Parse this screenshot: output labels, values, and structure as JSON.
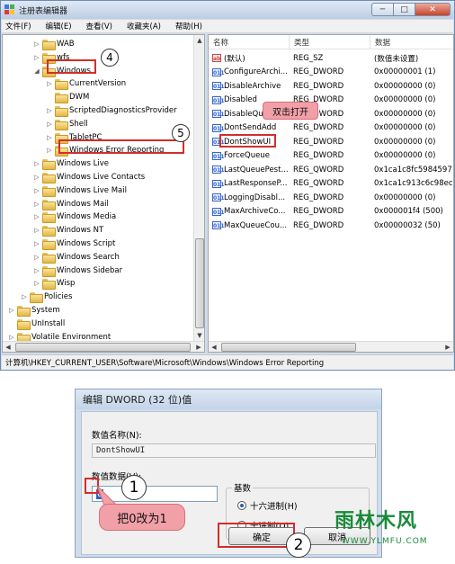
{
  "regedit": {
    "title": "注册表编辑器",
    "menu": [
      "文件(F)",
      "编辑(E)",
      "查看(V)",
      "收藏夹(A)",
      "帮助(H)"
    ],
    "window_buttons": {
      "min": "─",
      "max": "□",
      "close": "✕"
    },
    "tree": [
      {
        "label": "WAB",
        "indent": 3,
        "exp": "▷"
      },
      {
        "label": "wfs",
        "indent": 3,
        "exp": "▷"
      },
      {
        "label": "Windows",
        "indent": 3,
        "exp": "◢"
      },
      {
        "label": "CurrentVersion",
        "indent": 4,
        "exp": "▷"
      },
      {
        "label": "DWM",
        "indent": 4,
        "exp": ""
      },
      {
        "label": "ScriptedDiagnosticsProvider",
        "indent": 4,
        "exp": "▷"
      },
      {
        "label": "Shell",
        "indent": 4,
        "exp": "▷"
      },
      {
        "label": "TabletPC",
        "indent": 4,
        "exp": "▷"
      },
      {
        "label": "Windows Error Reporting",
        "indent": 4,
        "exp": "▷"
      },
      {
        "label": "Windows Live",
        "indent": 3,
        "exp": "▷"
      },
      {
        "label": "Windows Live Contacts",
        "indent": 3,
        "exp": "▷"
      },
      {
        "label": "Windows Live Mail",
        "indent": 3,
        "exp": "▷"
      },
      {
        "label": "Windows Mail",
        "indent": 3,
        "exp": "▷"
      },
      {
        "label": "Windows Media",
        "indent": 3,
        "exp": "▷"
      },
      {
        "label": "Windows NT",
        "indent": 3,
        "exp": "▷"
      },
      {
        "label": "Windows Script",
        "indent": 3,
        "exp": "▷"
      },
      {
        "label": "Windows Search",
        "indent": 3,
        "exp": "▷"
      },
      {
        "label": "Windows Sidebar",
        "indent": 3,
        "exp": "▷"
      },
      {
        "label": "Wisp",
        "indent": 3,
        "exp": "▷"
      },
      {
        "label": "Policies",
        "indent": 2,
        "exp": "▷"
      },
      {
        "label": "System",
        "indent": 1,
        "exp": "▷"
      },
      {
        "label": "UnInstall",
        "indent": 1,
        "exp": ""
      },
      {
        "label": "Volatile Environment",
        "indent": 1,
        "exp": "▷"
      }
    ],
    "columns": [
      "名称",
      "类型",
      "数据"
    ],
    "values": [
      {
        "icon": "ab",
        "name": "(默认)",
        "type": "REG_SZ",
        "data": "(数值未设置)"
      },
      {
        "icon": "dw",
        "name": "ConfigureArchi...",
        "type": "REG_DWORD",
        "data": "0x00000001 (1)"
      },
      {
        "icon": "dw",
        "name": "DisableArchive",
        "type": "REG_DWORD",
        "data": "0x00000000 (0)"
      },
      {
        "icon": "dw",
        "name": "Disabled",
        "type": "REG_DWORD",
        "data": "0x00000000 (0)"
      },
      {
        "icon": "dw",
        "name": "DisableQu",
        "type": "REG_DWORD",
        "data": "0x00000000 (0)"
      },
      {
        "icon": "dw",
        "name": "DontSendAdd",
        "type": "REG_DWORD",
        "data": "0x00000000 (0)"
      },
      {
        "icon": "dw",
        "name": "DontShowUI",
        "type": "REG_DWORD",
        "data": "0x00000000 (0)"
      },
      {
        "icon": "dw",
        "name": "ForceQueue",
        "type": "REG_DWORD",
        "data": "0x00000000 (0)"
      },
      {
        "icon": "dw",
        "name": "LastQueuePest...",
        "type": "REG_QWORD",
        "data": "0x1ca1c8fc5984597"
      },
      {
        "icon": "dw",
        "name": "LastResponseP...",
        "type": "REG_QWORD",
        "data": "0x1ca1c913c6c98ec"
      },
      {
        "icon": "dw",
        "name": "LoggingDisabl...",
        "type": "REG_DWORD",
        "data": "0x00000000 (0)"
      },
      {
        "icon": "dw",
        "name": "MaxArchiveCo...",
        "type": "REG_DWORD",
        "data": "0x000001f4 (500)"
      },
      {
        "icon": "dw",
        "name": "MaxQueueCou...",
        "type": "REG_DWORD",
        "data": "0x00000032 (50)"
      }
    ],
    "status": "计算机\\HKEY_CURRENT_USER\\Software\\Microsoft\\Windows\\Windows Error Reporting",
    "callout_double_click": "双击打开",
    "steps": {
      "s4": "4",
      "s5": "5"
    }
  },
  "dialog": {
    "title": "编辑 DWORD (32 位)值",
    "name_label": "数值名称(N):",
    "name_value": "DontShowUI",
    "data_label": "数值数据(V):",
    "data_value": "0",
    "base_label": "基数",
    "radio_hex": "十六进制(H)",
    "radio_dec": "十进制(D)",
    "ok_label": "确定",
    "cancel_label": "取消",
    "callout_change": "把0改为1",
    "steps": {
      "s1": "1",
      "s2": "2"
    }
  },
  "watermark": {
    "logo": "雨林木风",
    "url": "WWW.YLMFU.COM"
  },
  "colors": {
    "annotation_red": "#d42d2d",
    "callout_pink": "#f2a0a8",
    "selection_blue": "#3163c6",
    "watermark_green": "#1a8a3a"
  }
}
